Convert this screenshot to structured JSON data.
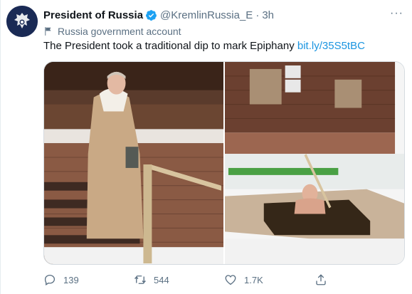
{
  "author": {
    "name": "President of Russia",
    "handle": "@KremlinRussia_E",
    "separator": "·",
    "time": "3h",
    "more_icon": "···"
  },
  "label": {
    "icon": "flag-icon",
    "text": "Russia government account"
  },
  "tweet": {
    "text": "The President took a traditional dip to mark Epiphany",
    "link": "bit.ly/35S5tBC"
  },
  "media": {
    "count": 2
  },
  "actions": {
    "reply_count": "139",
    "retweet_count": "544",
    "like_count": "1.7K"
  },
  "colors": {
    "text": "#0f1419",
    "muted": "#5b7083",
    "link": "#1b95e0",
    "verified": "#1da1f2"
  }
}
